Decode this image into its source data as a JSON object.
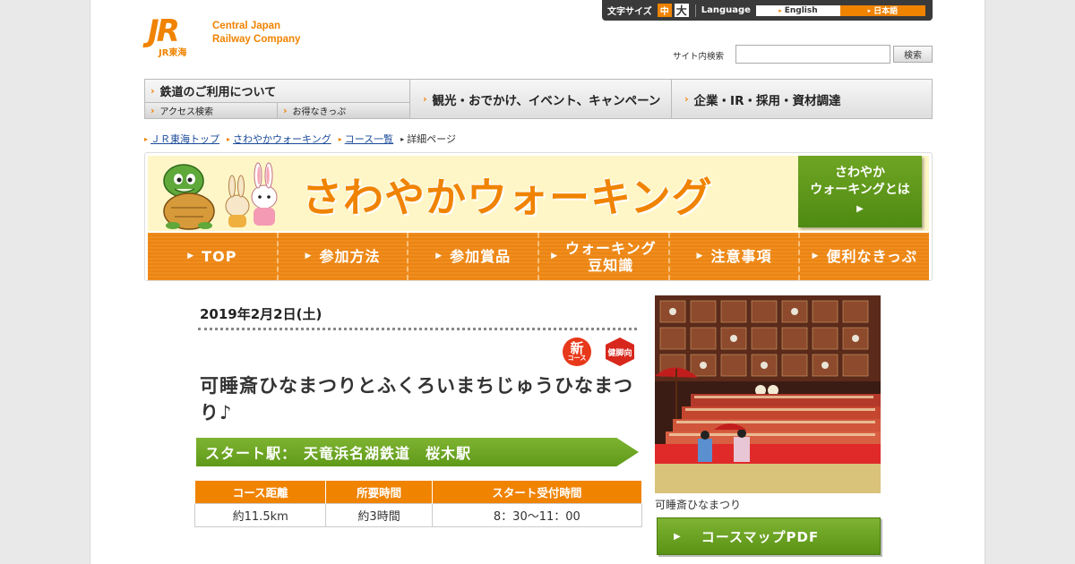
{
  "header": {
    "logo_mark": "JR",
    "logo_sub": "JR東海",
    "company_line1": "Central Japan",
    "company_line2": "Railway Company"
  },
  "util": {
    "font_size_label": "文字サイズ",
    "font_mid": "中",
    "font_big": "大",
    "language_label": "Language",
    "lang_en": "English",
    "lang_ja": "日本語"
  },
  "search": {
    "label": "サイト内検索",
    "value": "",
    "button": "検索"
  },
  "gnav": {
    "main1": "鉄道のご利用について",
    "sub1": "アクセス検索",
    "sub2": "お得なきっぷ",
    "main2": "観光・おでかけ、イベント、キャンペーン",
    "main3": "企業・IR・採用・資材調達"
  },
  "breadcrumb": [
    "ＪＲ東海トップ",
    "さわやかウォーキング",
    "コース一覧",
    "詳細ページ"
  ],
  "banner": {
    "title": "さわやかウォーキング",
    "about_line1": "さわやか",
    "about_line2": "ウォーキングとは",
    "nav": [
      {
        "label": "TOP"
      },
      {
        "label": "参加方法"
      },
      {
        "label": "参加賞品"
      },
      {
        "label_line1": "ウォーキング",
        "label_line2": "豆知識"
      },
      {
        "label": "注意事項"
      },
      {
        "label": "便利なきっぷ"
      }
    ]
  },
  "course": {
    "date": "2019年2月2日(土)",
    "badge_new": "新",
    "badge_new_sub": "コース",
    "badge_leg": "健脚向",
    "title": "可睡斎ひなまつりとふくろいまちじゅうひなまつり♪",
    "start_label": "スタート駅：",
    "start_station": "天竜浜名湖鉄道　桜木駅",
    "table_headers": [
      "コース距離",
      "所要時間",
      "スタート受付時間"
    ],
    "table_values": [
      "約11.5km",
      "約3時間",
      "8：30～11：00"
    ]
  },
  "photo": {
    "caption": "可睡斎ひなまつり"
  },
  "pdf_button": "コースマップPDF",
  "colors": {
    "brand_orange": "#f08300",
    "green": "#6fa523"
  }
}
